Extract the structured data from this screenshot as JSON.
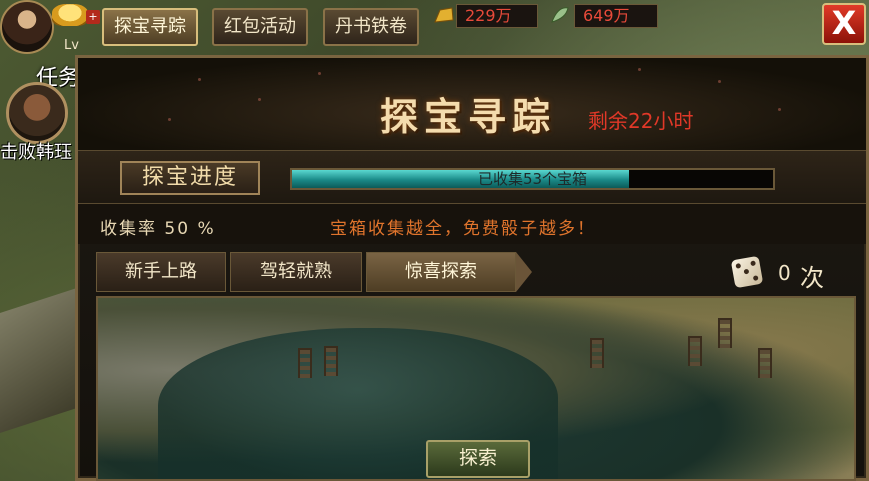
{
  "top_bar": {
    "level_text": "Lv",
    "tabs": [
      {
        "label": "探宝寻踪",
        "active": true
      },
      {
        "label": "红包活动",
        "active": false
      },
      {
        "label": "丹书铁卷",
        "active": false
      }
    ],
    "resources": [
      {
        "name": "gold-ingot-icon",
        "value": "229万"
      },
      {
        "name": "leaf-icon",
        "value": "649万"
      }
    ],
    "close_label": "X"
  },
  "quest": {
    "title": "任务",
    "text": "击败韩珏"
  },
  "panel": {
    "title": "探宝寻踪",
    "remaining": "剩余22小时",
    "progress_label": "探宝进度",
    "progress_text": "已收集53个宝箱",
    "progress_fraction": 0.7,
    "rate_label": "收集率 50 %",
    "hint": "宝箱收集越全，免费骰子越多！",
    "sub_tabs": [
      {
        "label": "新手上路",
        "active": false
      },
      {
        "label": "驾轻就熟",
        "active": false
      },
      {
        "label": "惊喜探索",
        "active": true
      }
    ],
    "dice_count": "0",
    "dice_unit": "次",
    "explore_button": "探索"
  },
  "colors": {
    "accent_gold": "#d8be7c",
    "progress_teal": "#1a8a88",
    "remain_red": "#e03828",
    "hint_orange": "#e0742c"
  }
}
